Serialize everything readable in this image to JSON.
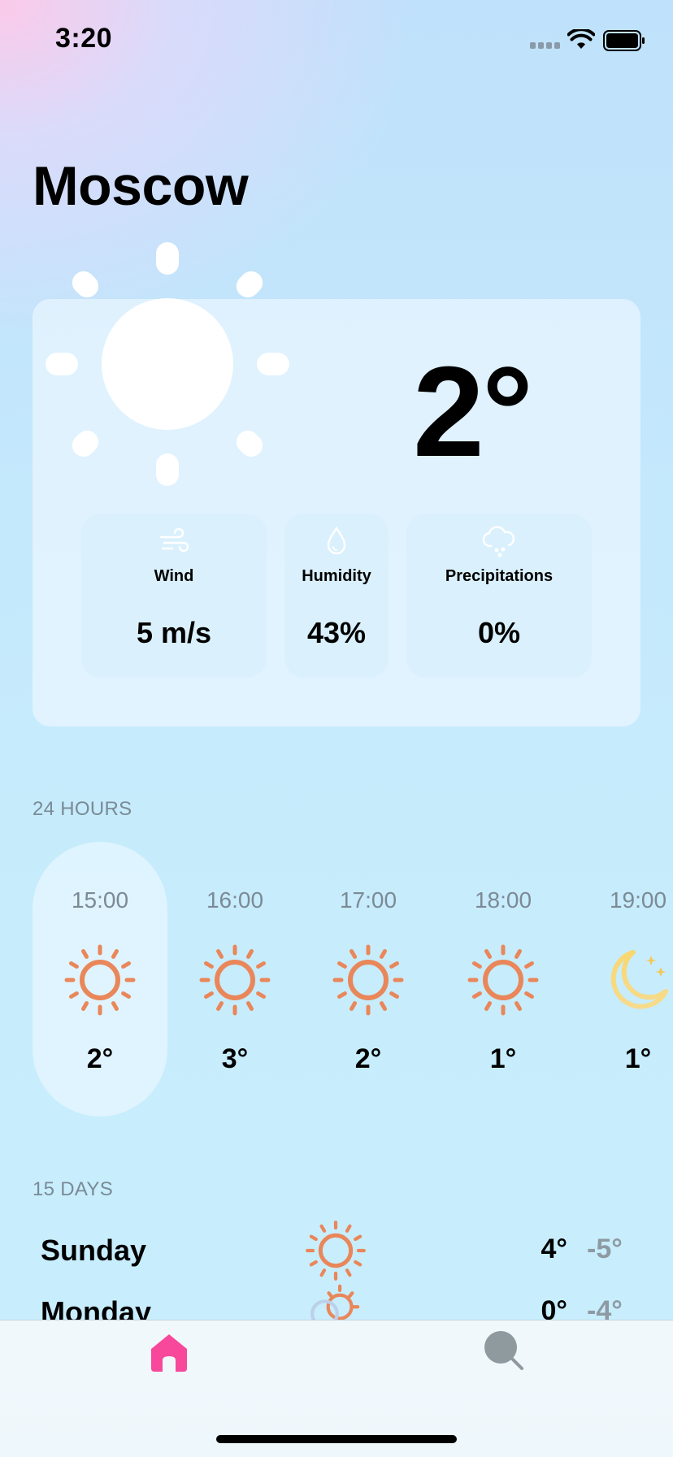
{
  "status_bar": {
    "time": "3:20"
  },
  "city": "Moscow",
  "current": {
    "temperature": "2°",
    "icon": "sun-icon",
    "stats": [
      {
        "icon": "wind-icon",
        "label": "Wind",
        "value": "5 m/s"
      },
      {
        "icon": "droplet-icon",
        "label": "Humidity",
        "value": "43%"
      },
      {
        "icon": "cloud-rain-icon",
        "label": "Precipitations",
        "value": "0%"
      }
    ]
  },
  "hourly": {
    "title": "24 HOURS",
    "items": [
      {
        "time": "15:00",
        "icon": "sun-icon",
        "temp": "2°",
        "selected": true
      },
      {
        "time": "16:00",
        "icon": "sun-icon",
        "temp": "3°"
      },
      {
        "time": "17:00",
        "icon": "sun-icon",
        "temp": "2°"
      },
      {
        "time": "18:00",
        "icon": "sun-icon",
        "temp": "1°"
      },
      {
        "time": "19:00",
        "icon": "moon-stars-icon",
        "temp": "1°"
      }
    ]
  },
  "daily": {
    "title": "15 DAYS",
    "items": [
      {
        "day": "Sunday",
        "icon": "sun-icon",
        "high": "4°",
        "low": "-5°"
      },
      {
        "day": "Monday",
        "icon": "sun-cloud-icon",
        "high": "0°",
        "low": "-4°"
      }
    ]
  },
  "tab_bar": {
    "active": "home",
    "tabs": [
      "home-icon",
      "search-icon"
    ]
  },
  "colors": {
    "accent": "#f8489b",
    "sun_orange": "#e9875a",
    "moon_yellow": "#f7d675",
    "muted_text": "#7c8a96"
  }
}
